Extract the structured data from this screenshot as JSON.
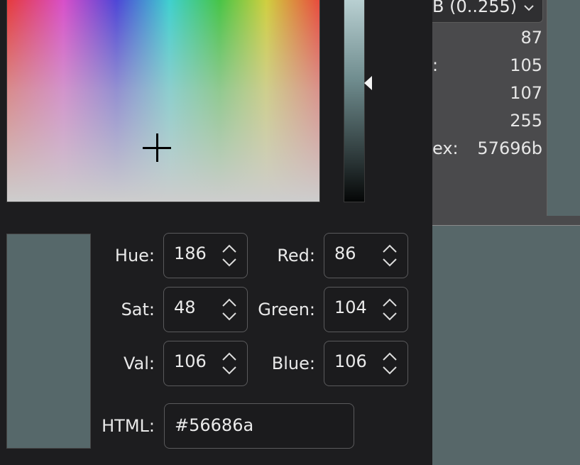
{
  "dialog": {
    "selected_color": "#56686a",
    "fields": {
      "hue": {
        "label": "Hue:",
        "value": "186"
      },
      "sat": {
        "label": "Sat:",
        "value": "48"
      },
      "val": {
        "label": "Val:",
        "value": "106"
      },
      "red": {
        "label": "Red:",
        "value": "86"
      },
      "green": {
        "label": "Green:",
        "value": "104"
      },
      "blue": {
        "label": "Blue:",
        "value": "106"
      },
      "html": {
        "label": "HTML:",
        "value": "#56686a"
      }
    },
    "icons": {
      "up": "chevron-up-icon",
      "down": "chevron-down-icon",
      "crosshair": "crosshair-icon",
      "slider_handle": "slider-arrow-icon"
    }
  },
  "background_panel": {
    "mode_dropdown": "B (0..255)",
    "values": [
      {
        "label": "",
        "value": "87"
      },
      {
        "label": ":",
        "value": "105"
      },
      {
        "label": "",
        "value": "107"
      },
      {
        "label": "",
        "value": "255"
      },
      {
        "label": "ex:",
        "value": "57696b"
      }
    ],
    "color": "#576769"
  }
}
